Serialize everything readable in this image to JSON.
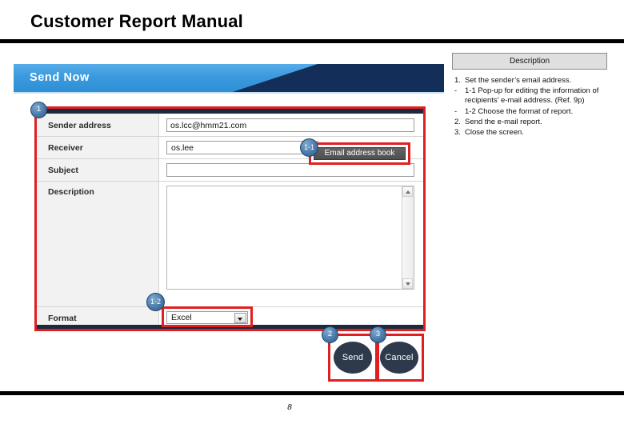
{
  "slide": {
    "title": "Customer Report Manual",
    "page_number": "8"
  },
  "banner": {
    "title": "Send Now"
  },
  "description_panel": {
    "header": "Description",
    "items": [
      {
        "marker": "1.",
        "text": "Set the sender’s email address."
      },
      {
        "marker": "-",
        "text": "1-1 Pop-up for editing the information of recipients’ e-mail address. (Ref. 9p)"
      },
      {
        "marker": "-",
        "text": "1-2 Choose the format of report."
      },
      {
        "marker": "2.",
        "text": "Send the e-mail report."
      },
      {
        "marker": "3.",
        "text": "Close the screen."
      }
    ]
  },
  "form": {
    "rows": {
      "sender": {
        "label": "Sender address",
        "value": "os.lcc@hmm21.com",
        "placeholder": ""
      },
      "receiver": {
        "label": "Receiver",
        "value": "os.lee",
        "placeholder": ""
      },
      "subject": {
        "label": "Subject",
        "value": "",
        "placeholder": ""
      },
      "description": {
        "label": "Description",
        "value": "",
        "placeholder": ""
      },
      "format": {
        "label": "Format",
        "value": "Excel",
        "options": [
          "Excel"
        ]
      }
    },
    "address_book_button": "Email address book"
  },
  "actions": {
    "send": "Send",
    "cancel": "Cancel"
  },
  "badges": {
    "step1": "1",
    "step1_1": "1-1",
    "step1_2": "1-2",
    "step2": "2",
    "step3": "3"
  },
  "colors": {
    "highlight_red": "#e02020",
    "banner_blue": "#3b9ade",
    "banner_navy": "#132e59",
    "button_navy": "#2e3a4b",
    "badge_blue": "#4a7aa8"
  }
}
